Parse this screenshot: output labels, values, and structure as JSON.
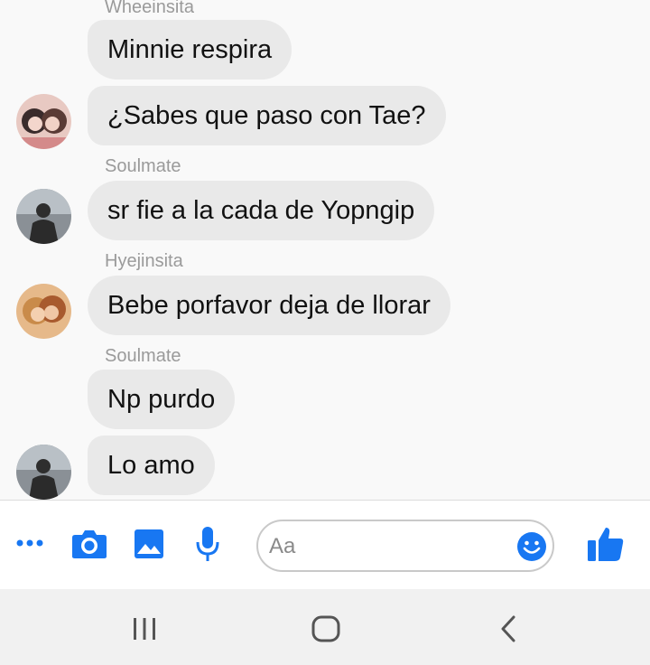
{
  "messages": [
    {
      "sender": "Wheeinsita",
      "text": "Minnie respira"
    },
    {
      "sender": "",
      "text": "¿Sabes que paso con Tae?"
    },
    {
      "sender": "Soulmate",
      "text": "sr fie a la cada de Yopngip"
    },
    {
      "sender": "Hyejinsita",
      "text": "Bebe porfavor deja de llorar"
    },
    {
      "sender": "Soulmate",
      "text": "Np purdo"
    },
    {
      "sender": "",
      "text": "Lo amo"
    }
  ],
  "composer": {
    "placeholder": "Aa",
    "accent_color": "#1877f2",
    "icons": [
      "more-icon",
      "camera-icon",
      "gallery-icon",
      "microphone-icon",
      "emoji-icon",
      "thumbs-up-icon"
    ]
  },
  "navbar": {
    "icons": [
      "recent-apps-icon",
      "home-icon",
      "back-icon"
    ]
  }
}
